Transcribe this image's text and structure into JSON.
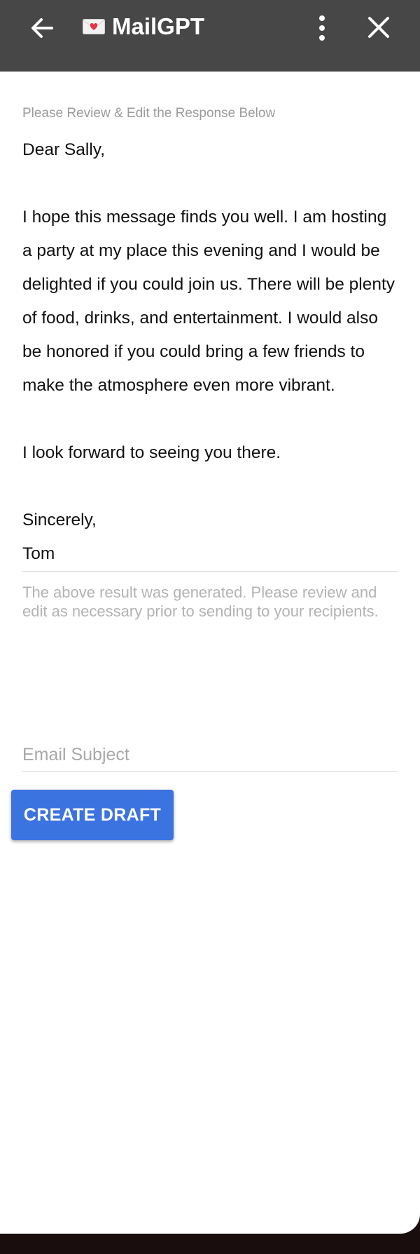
{
  "header": {
    "title": "MailGPT",
    "back_icon": "arrow-left-icon",
    "logo_icon": "love-letter-icon",
    "more_icon": "vertical-dots-icon",
    "close_icon": "close-icon"
  },
  "review": {
    "label": "Please Review & Edit the Response Below",
    "response": "Dear Sally,\n\nI hope this message finds you well. I am hosting a party at my place this evening and I would be delighted if you could join us. There will be plenty of food, drinks, and entertainment. I would also be honored if you could bring a few friends to make the atmosphere even more vibrant.\n\nI look forward to seeing you there.\n\nSincerely,\nTom",
    "helper": "The above result was generated. Please review and edit as necessary prior to sending to your recipients."
  },
  "subject": {
    "placeholder": "Email Subject",
    "value": ""
  },
  "actions": {
    "create_draft_label": "CREATE DRAFT"
  },
  "colors": {
    "header_bg": "#474747",
    "primary_button": "#3b73e0",
    "muted_text": "#9b9b9b"
  }
}
